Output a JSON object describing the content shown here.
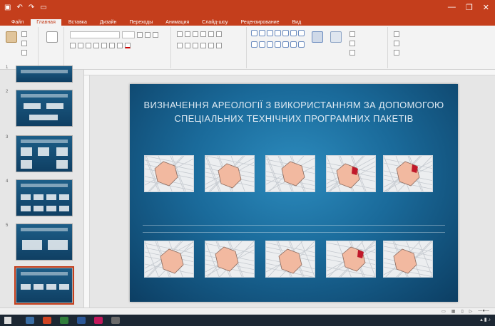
{
  "window": {
    "title": "",
    "qat_icons": [
      "save-icon",
      "undo-icon",
      "redo-icon",
      "present-icon"
    ],
    "controls": [
      "—",
      "❐",
      "✕"
    ]
  },
  "ribbon_tabs": [
    "Файл",
    "Главная",
    "Вставка",
    "Дизайн",
    "Переходы",
    "Анимация",
    "Слайд-шоу",
    "Рецензирование",
    "Вид"
  ],
  "active_tab": 1,
  "tell_me": "",
  "share": "",
  "ribbon_groups": [
    "",
    "",
    "",
    "",
    "",
    ""
  ],
  "slide": {
    "title": "ВИЗНАЧЕННЯ АРЕОЛОГІЇ З ВИКОРИСТАННЯМ ЗА ДОПОМОГОЮ СПЕЦІАЛЬНИХ ТЕХНІЧНИХ ПРОГРАМНИХ ПАКЕТІВ"
  },
  "thumbnails": [
    "1",
    "2",
    "3",
    "4",
    "5"
  ],
  "status": {
    "left": "",
    "right": ""
  },
  "colors": {
    "accent": "#c43e1c",
    "slide_bg": "#1a6a9a",
    "highlight": "#f2b9a0",
    "mark": "#c0182a"
  }
}
